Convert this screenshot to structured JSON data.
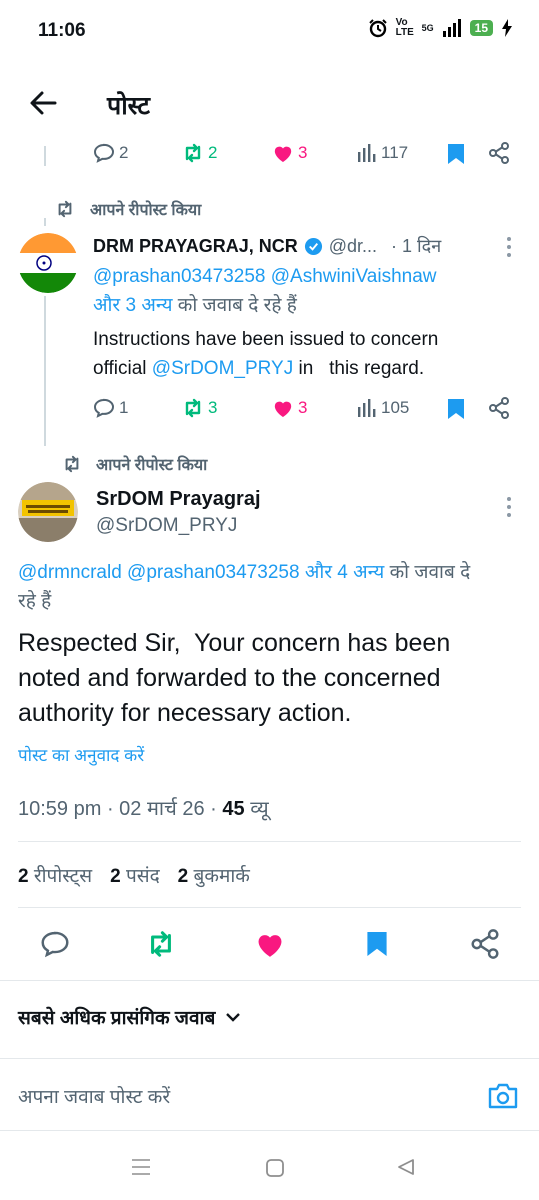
{
  "status_bar": {
    "time": "11:06",
    "volte": "Vo LTE",
    "network": "5G",
    "battery": "15"
  },
  "header": {
    "title": "पोस्ट"
  },
  "top_actions": {
    "replies": "2",
    "reposts": "2",
    "likes": "3",
    "views": "117"
  },
  "post1": {
    "repost_label": "आपने रीपोस्ट किया",
    "name": "DRM PRAYAGRAJ, NCR",
    "handle": "@dr...",
    "time": "· 1 दिन",
    "reply_mentions": "@prashan03473258 @AshwiniVaishnaw",
    "reply_others": "और 3 अन्य",
    "reply_suffix": "को जवाब दे रहे हैं",
    "text_line1": "Instructions have been issued to concern",
    "text_prefix": "official ",
    "text_mention": "@SrDOM_PRYJ",
    "text_suffix": " in   this regard.",
    "replies": "1",
    "reposts": "3",
    "likes": "3",
    "views": "105"
  },
  "post2": {
    "repost_label": "आपने रीपोस्ट किया",
    "name": "SrDOM Prayagraj",
    "handle": "@SrDOM_PRYJ",
    "reply_mentions": "@drmncrald @prashan03473258",
    "reply_others": "और 4 अन्य",
    "reply_suffix": "को जवाब दे",
    "reply_suffix2": "रहे हैं",
    "text_line1": "Respected Sir,  Your concern has been",
    "text_line2": "noted and forwarded to the concerned",
    "text_line3": "authority for necessary action.",
    "translate": "पोस्ट का अनुवाद करें",
    "timestamp": "10:59 pm · 02 मार्च 26 · ",
    "views_count": "45",
    "views_label": " व्यू",
    "stats": [
      {
        "count": "2",
        "label": "रीपोस्ट्स"
      },
      {
        "count": "2",
        "label": "पसंद"
      },
      {
        "count": "2",
        "label": "बुकमार्क"
      }
    ]
  },
  "sort": {
    "label": "सबसे अधिक प्रासंगिक जवाब"
  },
  "reply_box": {
    "placeholder": "अपना जवाब पोस्ट करें"
  },
  "colors": {
    "accent": "#1d9bf0",
    "repost_green": "#00ba7c",
    "like_pink": "#f91880",
    "muted": "#536471"
  }
}
